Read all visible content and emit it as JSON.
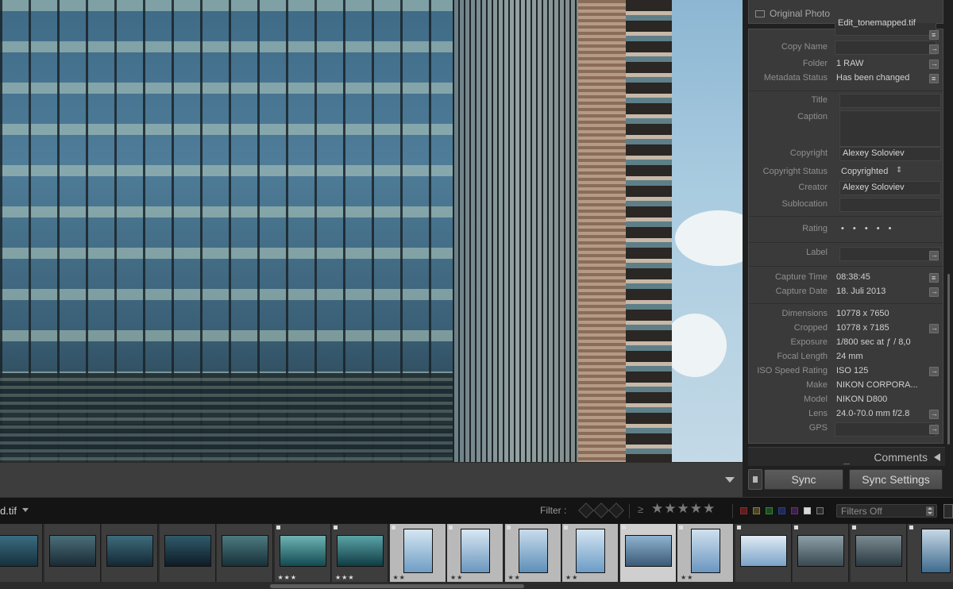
{
  "header_panel": {
    "original_photo_label": "Original Photo"
  },
  "metadata": {
    "edit_name": "Edit_tonemapped.tif",
    "copy_name_label": "Copy Name",
    "folder_label": "Folder",
    "folder": "1 RAW",
    "metadata_status_label": "Metadata Status",
    "metadata_status": "Has been changed",
    "title_label": "Title",
    "caption_label": "Caption",
    "copyright_label": "Copyright",
    "copyright": "Alexey Soloviev",
    "copyright_status_label": "Copyright Status",
    "copyright_status": "Copyrighted",
    "creator_label": "Creator",
    "creator": "Alexey Soloviev",
    "sublocation_label": "Sublocation",
    "rating_label": "Rating",
    "rating_dots": "• • • • •",
    "label_label": "Label",
    "capture_time_label": "Capture Time",
    "capture_time": "08:38:45",
    "capture_date_label": "Capture Date",
    "capture_date": "18. Juli 2013",
    "dimensions_label": "Dimensions",
    "dimensions": "10778 x 7650",
    "cropped_label": "Cropped",
    "cropped": "10778 x 7185",
    "exposure_label": "Exposure",
    "exposure": "1/800 sec at ƒ / 8,0",
    "focal_length_label": "Focal Length",
    "focal_length": "24 mm",
    "iso_label": "ISO Speed Rating",
    "iso": "ISO 125",
    "make_label": "Make",
    "make": "NIKON CORPORA...",
    "model_label": "Model",
    "model": "NIKON D800",
    "lens_label": "Lens",
    "lens": "24.0-70.0 mm f/2.8",
    "gps_label": "GPS"
  },
  "comments": {
    "label": "Comments"
  },
  "sync": {
    "sync_label": "Sync",
    "sync_settings_label": "Sync Settings"
  },
  "filmstrip": {
    "filename": "d.tif",
    "filter_label": "Filter :",
    "rating_op": "≥",
    "filter_stars": "★★★★★",
    "filters_off": "Filters Off",
    "thumbs": [
      {
        "stars": ""
      },
      {
        "stars": ""
      },
      {
        "stars": ""
      },
      {
        "stars": ""
      },
      {
        "stars": ""
      },
      {
        "stars": "★★★"
      },
      {
        "stars": "★★★"
      },
      {
        "stars": "★★"
      },
      {
        "stars": "★★"
      },
      {
        "stars": "★★"
      },
      {
        "stars": "★★"
      },
      {
        "stars": ""
      },
      {
        "stars": "★★"
      },
      {
        "stars": ""
      },
      {
        "stars": ""
      },
      {
        "stars": ""
      },
      {
        "stars": ""
      }
    ]
  },
  "colors": {
    "panel_bg": "#3a3a3a",
    "filmstrip_bg": "#141414",
    "label_text": "#8f8f8f",
    "value_text": "#d0d0d0"
  }
}
